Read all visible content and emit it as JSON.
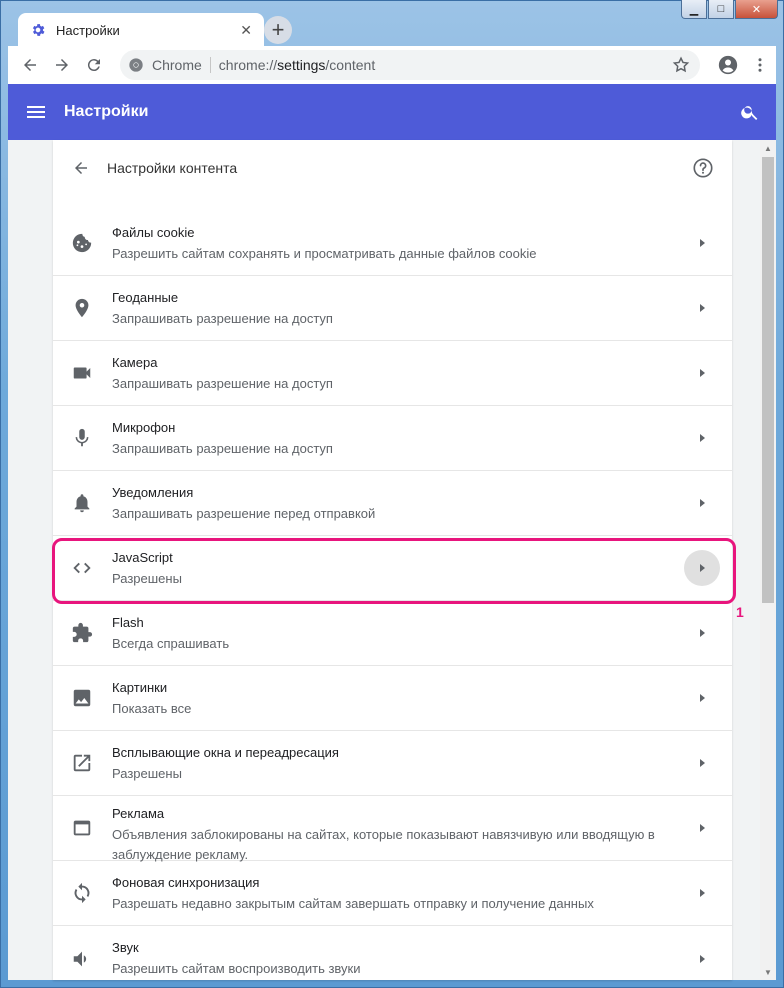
{
  "window": {
    "controls": {
      "minimize": "▁",
      "maximize": "□",
      "close": "✕"
    }
  },
  "tab": {
    "title": "Настройки",
    "close": "✕",
    "new_tab": "+"
  },
  "omnibox": {
    "site_chip": "Chrome",
    "url_host": "chrome://",
    "url_main": "settings",
    "url_path": "/content"
  },
  "header": {
    "title": "Настройки",
    "accent_color": "#4e5bd8"
  },
  "content_settings": {
    "title": "Настройки контента",
    "rows": [
      {
        "icon": "cookie-icon",
        "title": "Файлы cookie",
        "subtitle": "Разрешить сайтам сохранять и просматривать данные файлов cookie"
      },
      {
        "icon": "location-icon",
        "title": "Геоданные",
        "subtitle": "Запрашивать разрешение на доступ"
      },
      {
        "icon": "camera-icon",
        "title": "Камера",
        "subtitle": "Запрашивать разрешение на доступ"
      },
      {
        "icon": "microphone-icon",
        "title": "Микрофон",
        "subtitle": "Запрашивать разрешение на доступ"
      },
      {
        "icon": "bell-icon",
        "title": "Уведомления",
        "subtitle": "Запрашивать разрешение перед отправкой"
      },
      {
        "icon": "code-icon",
        "title": "JavaScript",
        "subtitle": "Разрешены"
      },
      {
        "icon": "puzzle-icon",
        "title": "Flash",
        "subtitle": "Всегда спрашивать"
      },
      {
        "icon": "image-icon",
        "title": "Картинки",
        "subtitle": "Показать все"
      },
      {
        "icon": "open-in-new-icon",
        "title": "Всплывающие окна и переадресация",
        "subtitle": "Разрешены"
      },
      {
        "icon": "ad-window-icon",
        "title": "Реклама",
        "subtitle": "Объявления заблокированы на сайтах, которые показывают навязчивую или вводящую в заблуждение рекламу."
      },
      {
        "icon": "sync-icon",
        "title": "Фоновая синхронизация",
        "subtitle": "Разрешать недавно закрытым сайтам завершать отправку и получение данных"
      },
      {
        "icon": "volume-icon",
        "title": "Звук",
        "subtitle": "Разрешить сайтам воспроизводить звуки"
      }
    ]
  },
  "annotation": {
    "number": "1",
    "color": "#e8157d"
  }
}
